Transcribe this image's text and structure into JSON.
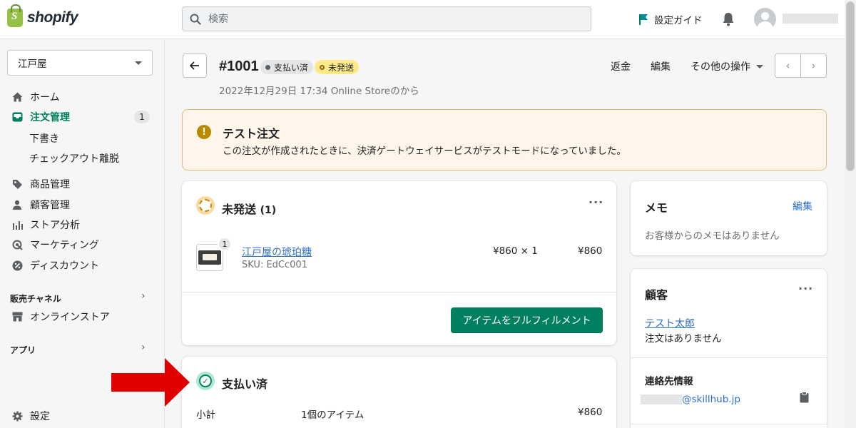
{
  "topbar": {
    "logo_text": "shopify",
    "search_placeholder": "検索",
    "setup_guide": "設定ガイド"
  },
  "sidebar": {
    "store_name": "江戸屋",
    "items": [
      {
        "label": "ホーム"
      },
      {
        "label": "注文管理",
        "count": "1"
      },
      {
        "label": "商品管理"
      },
      {
        "label": "顧客管理"
      },
      {
        "label": "ストア分析"
      },
      {
        "label": "マーケティング"
      },
      {
        "label": "ディスカウント"
      }
    ],
    "order_subitems": [
      "下書き",
      "チェックアウト離脱"
    ],
    "sales_channels": "販売チャネル",
    "online_store": "オンラインストア",
    "apps": "アプリ",
    "settings": "設定"
  },
  "order": {
    "number": "#1001",
    "payment_status": "支払い済",
    "fulfillment_status": "未発送",
    "date_line": "2022年12月29日 17:34 Online Storeのから",
    "actions": {
      "refund": "返金",
      "edit": "編集",
      "more": "その他の操作"
    }
  },
  "banner": {
    "title": "テスト注文",
    "text": "この注文が作成されたときに、決済ゲートウェイサービスがテストモードになっていました。"
  },
  "unfulfilled": {
    "title": "未発送",
    "count": "(1)",
    "item": {
      "name": "江戸屋の琥珀糖",
      "sku": "SKU: EdCc001",
      "qty_badge": "1",
      "unit_price": "¥860 × 1",
      "total": "¥860"
    },
    "fulfill_button": "アイテムをフルフィルメント"
  },
  "paid": {
    "title": "支払い済",
    "subtotal_label": "小計",
    "subtotal_items": "1個のアイテム",
    "subtotal_value": "¥860"
  },
  "notes": {
    "title": "メモ",
    "edit": "編集",
    "empty": "お客様からのメモはありません"
  },
  "customer": {
    "title": "顧客",
    "name": "テスト太郎",
    "orders": "注文はありません",
    "contact_title": "連絡先情報",
    "email_domain": "@skillhub.jp"
  },
  "colors": {
    "primary": "#008060",
    "link": "#2c6ecb",
    "warning_bg": "#fff5ea",
    "arrow": "#e00000"
  }
}
